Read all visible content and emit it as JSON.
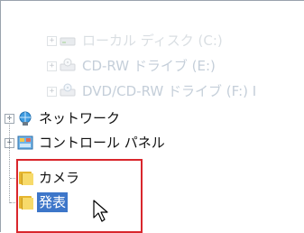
{
  "tree": {
    "items": [
      {
        "label": "ローカル ディスク (C:)",
        "icon": "drive-icon",
        "expander": "+",
        "state": "faded"
      },
      {
        "label": "CD-RW ドライブ (E:)",
        "icon": "cd-drive-icon",
        "expander": "+",
        "state": "faded"
      },
      {
        "label": "DVD/CD-RW ドライブ (F:) I",
        "icon": "dvd-drive-icon",
        "expander": "+",
        "state": "faded"
      },
      {
        "label": "ネットワーク",
        "icon": "network-icon",
        "expander": "+",
        "state": "normal"
      },
      {
        "label": "コントロール パネル",
        "icon": "control-panel-icon",
        "expander": "+",
        "state": "normal"
      },
      {
        "label": "カメラ",
        "icon": "folder-icon",
        "expander": "",
        "state": "normal"
      },
      {
        "label": "発表",
        "icon": "folder-icon",
        "expander": "",
        "state": "selected"
      }
    ]
  },
  "colors": {
    "highlight_border": "#d9262c",
    "selection_bg": "#3d76c9"
  }
}
